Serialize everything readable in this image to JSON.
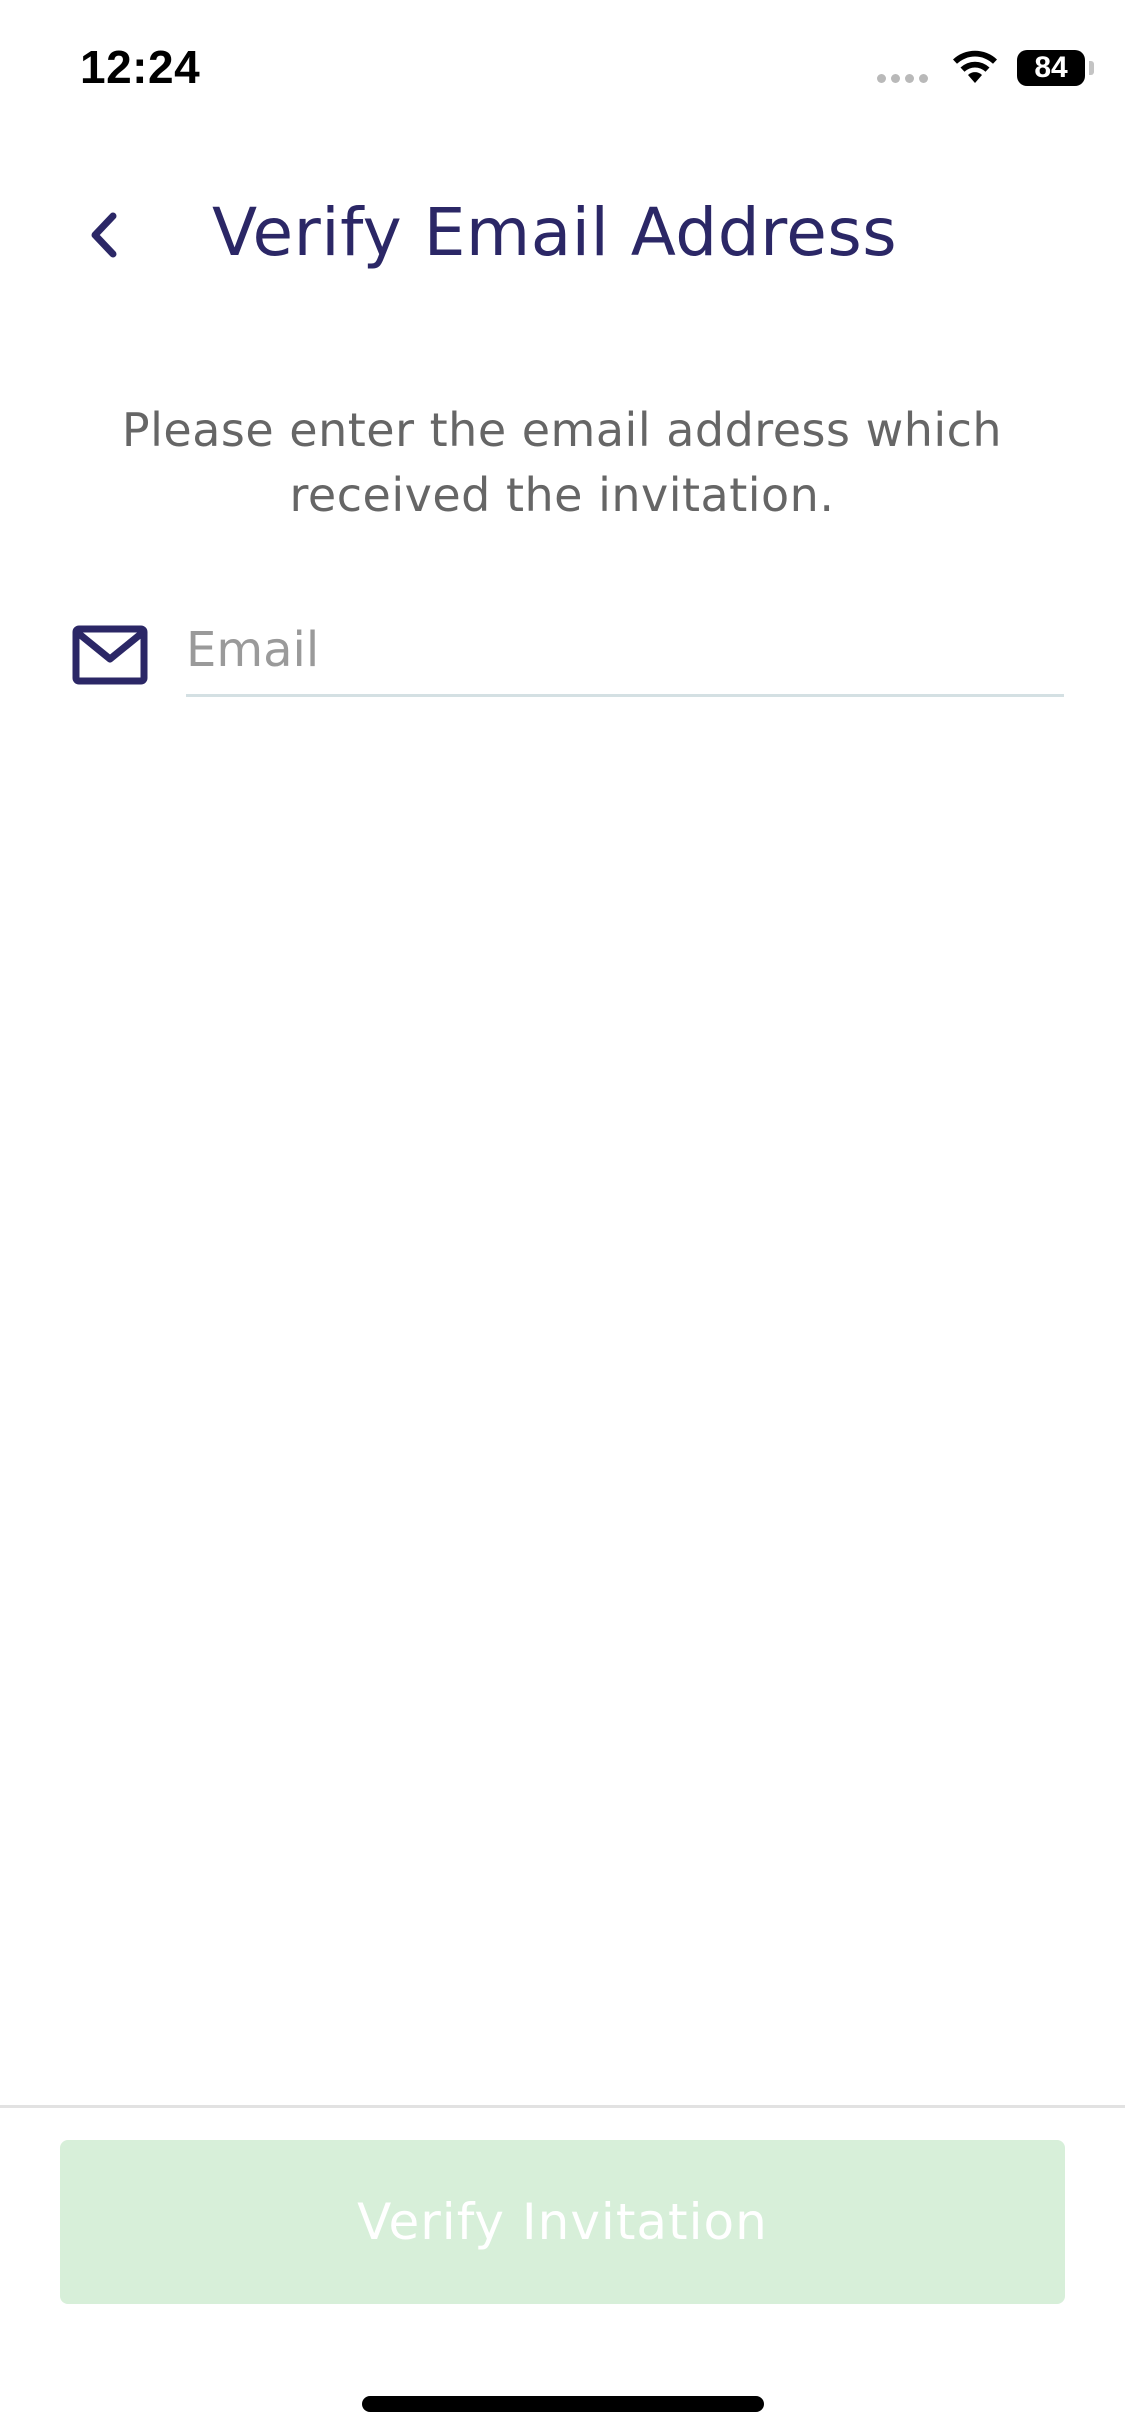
{
  "status_bar": {
    "time": "12:24",
    "battery_level": "84"
  },
  "header": {
    "title": "Verify Email Address",
    "back_icon": "chevron-left-icon"
  },
  "instruction": {
    "line1": "Please enter the email address which",
    "line2": "received the invitation."
  },
  "email_field": {
    "placeholder": "Email",
    "value": "",
    "icon": "mail-icon"
  },
  "footer": {
    "verify_label": "Verify Invitation"
  },
  "colors": {
    "primary": "#2b2766",
    "button_disabled_bg": "#d7efd9",
    "text_secondary": "#666666",
    "placeholder": "#9a9a9a",
    "input_underline": "#d4e0e3"
  }
}
